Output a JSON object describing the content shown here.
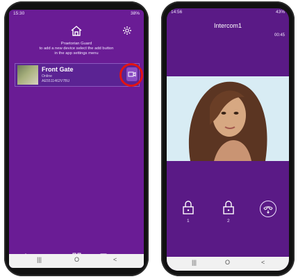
{
  "left_phone": {
    "status_time": "15:30",
    "status_right": "38%",
    "app_name": "Praetorian Guard",
    "instructions_line1": "to add a new device select the add button",
    "instructions_line2": "in the app settings menu",
    "device": {
      "name": "Front Gate",
      "status": "Online",
      "id": "AE5511462V7BU"
    },
    "nav": {
      "recent": "|||",
      "home": "O",
      "back": "<"
    },
    "highlight_color": "#e31313"
  },
  "right_phone": {
    "status_time": "14:56",
    "status_right": "43%",
    "title": "Intercom1",
    "timer": "00:45",
    "locks": [
      {
        "label": "1"
      },
      {
        "label": "2"
      }
    ],
    "nav": {
      "recent": "|||",
      "home": "O",
      "back": "<"
    }
  },
  "colors": {
    "purple_bg": "#6a1c95",
    "card_bg": "#5b2393",
    "accent_purple": "#8a4cc4"
  }
}
